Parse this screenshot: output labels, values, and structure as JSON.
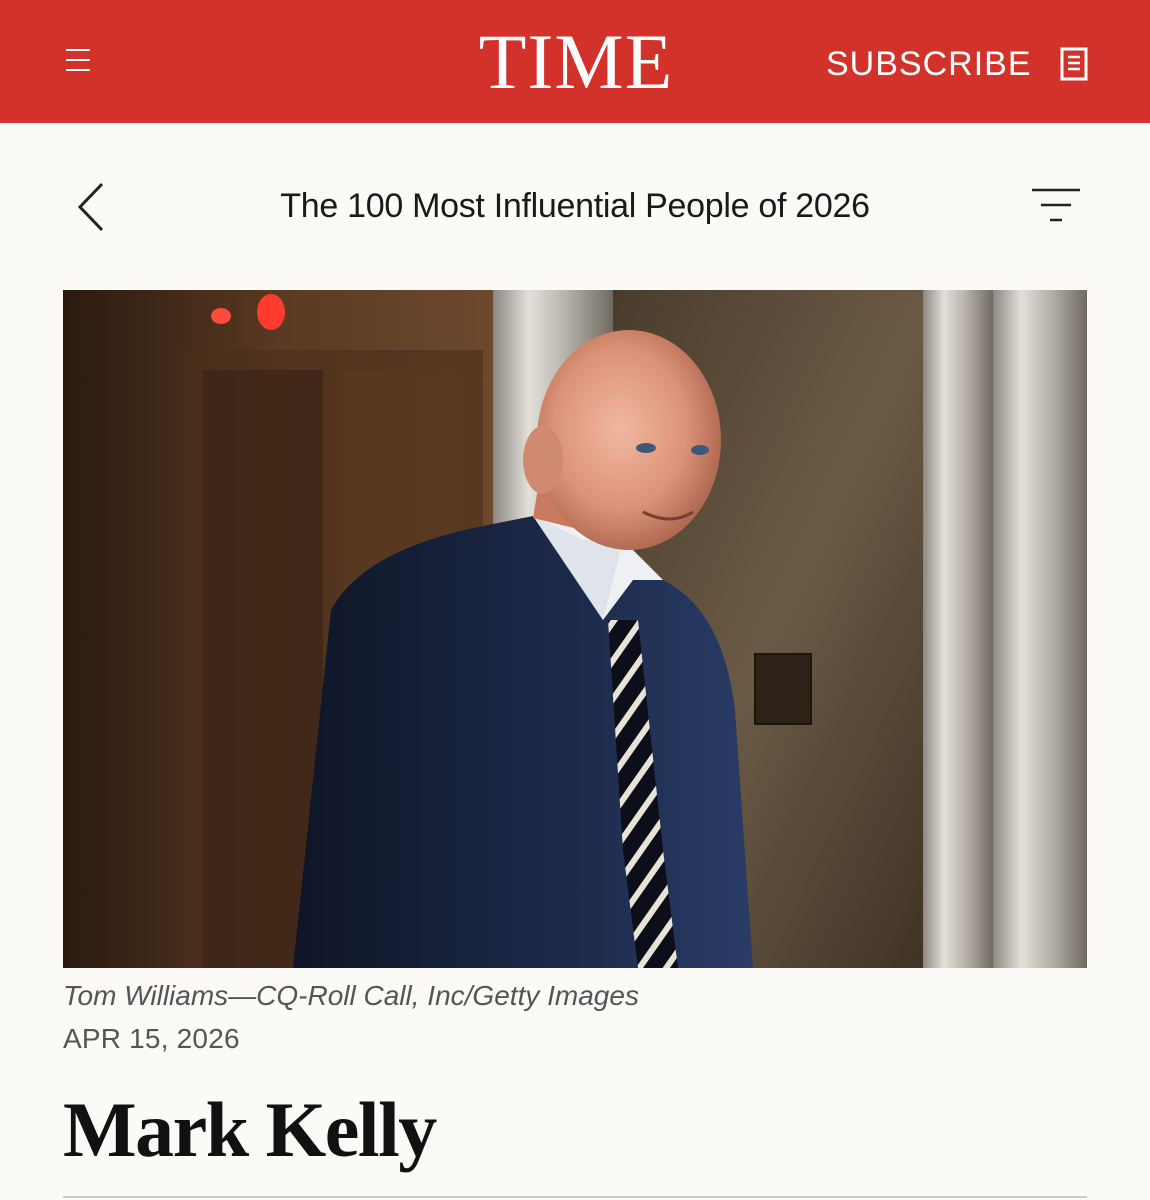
{
  "header": {
    "logo": "TIME",
    "subscribe_label": "SUBSCRIBE",
    "menu_icon": "hamburger-menu-icon",
    "subscribe_icon": "magazine-icon",
    "background_color": "#d3322b"
  },
  "nav": {
    "title": "The 100 Most Influential People of 2026",
    "back_icon": "chevron-left-icon",
    "filter_icon": "filter-icon"
  },
  "article": {
    "photo_alt": "Mark Kelly",
    "photo_credit": "Tom Williams—CQ-Roll Call, Inc/Getty Images",
    "date": "APR 15, 2026",
    "name": "Mark Kelly"
  }
}
